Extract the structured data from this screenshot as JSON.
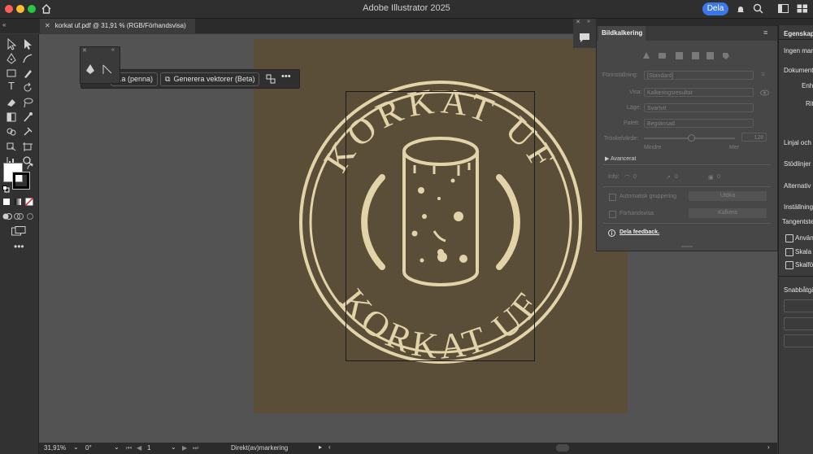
{
  "app": {
    "title": "Adobe Illustrator 2025",
    "share_label": "Dela"
  },
  "document": {
    "tab_label": "korkat uf.pdf @ 31,91 % (RGB/Förhandsvisa)"
  },
  "context_bar": {
    "partial_label": "...a (penna)",
    "generate_label": "Generera vektorer (Beta)"
  },
  "artwork": {
    "top_text": "KORKAT UF",
    "bottom_text": "KORKAT UF",
    "fill_color": "#5a4e38",
    "line_color": "#e2d3a8"
  },
  "trace_panel": {
    "tab": "Bildkalkering",
    "preset_label": "Förinställning:",
    "preset_value": "[Standard]",
    "view_label": "Visa:",
    "view_value": "Kalkeringsresultat",
    "mode_label": "Läge:",
    "mode_value": "Svartvit",
    "palette_label": "Palett:",
    "palette_value": "Begränsad",
    "threshold_label": "Tröskelvärde:",
    "threshold_value": "128",
    "less": "Mindre",
    "more": "Mer",
    "advanced": "Avancerat",
    "info_label": "Info:",
    "info_a": "0",
    "info_b": "0",
    "info_c": "0",
    "auto_group": "Automatisk gruppering",
    "expand_btn": "Utöka",
    "preview": "Förhandsvisa",
    "trace_btn": "Kalkera",
    "feedback": "Dela feedback."
  },
  "properties_panel": {
    "tab": "Egenskape",
    "no_selection": "Ingen mark",
    "document": "Dokument",
    "unit": "Enhe",
    "rit": "Rit",
    "rulers": "Linjal och s",
    "guides": "Stödlinjer",
    "alignment": "Alternativ f",
    "settings": "Inställninga",
    "key_step": "Tangentsteg",
    "opt1": "Använd",
    "opt2": "Skala h",
    "opt3": "Skalför",
    "quick_actions": "Snabbåtgä"
  },
  "statusbar": {
    "zoom": "31,91%",
    "rotation": "0°",
    "artboard": "1",
    "tool": "Direkt(av)markering"
  }
}
